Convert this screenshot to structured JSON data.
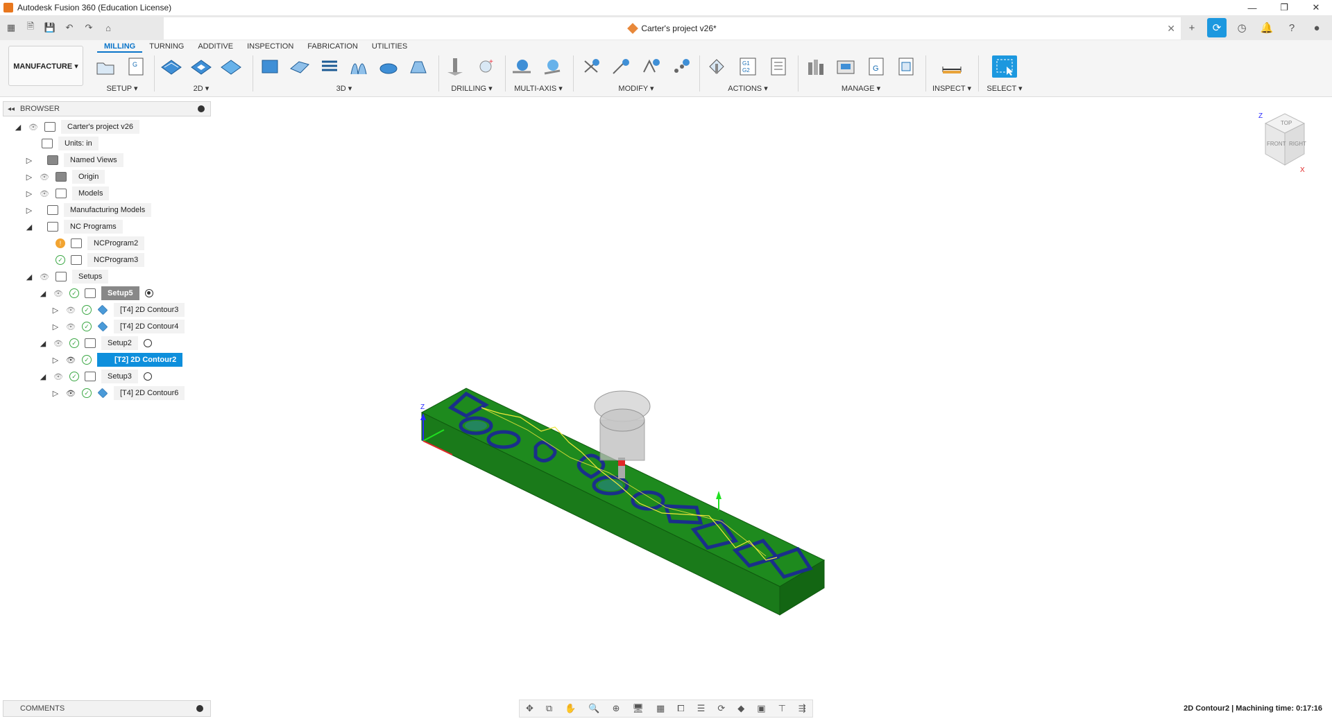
{
  "window": {
    "title": "Autodesk Fusion 360 (Education License)",
    "controls": [
      "—",
      "❐",
      "✕"
    ]
  },
  "document": {
    "tab_title": "Carter's project v26*"
  },
  "workspace": {
    "label": "MANUFACTURE ▾"
  },
  "ribbon": {
    "tabs": [
      "MILLING",
      "TURNING",
      "ADDITIVE",
      "INSPECTION",
      "FABRICATION",
      "UTILITIES"
    ],
    "groups": {
      "setup": "SETUP ▾",
      "two_d": "2D ▾",
      "three_d": "3D ▾",
      "drilling": "DRILLING ▾",
      "multi_axis": "MULTI-AXIS ▾",
      "modify": "MODIFY ▾",
      "actions": "ACTIONS ▾",
      "manage": "MANAGE ▾",
      "inspect": "INSPECT ▾",
      "select": "SELECT ▾"
    }
  },
  "browser": {
    "title": "BROWSER",
    "tree": {
      "root": "Carter's project v26",
      "units": "Units: in",
      "named_views": "Named Views",
      "origin": "Origin",
      "models": "Models",
      "manufacturing_models": "Manufacturing Models",
      "nc_programs": "NC Programs",
      "ncprogram2": "NCProgram2",
      "ncprogram3": "NCProgram3",
      "setups": "Setups",
      "setup5": "Setup5",
      "contour3": "[T4] 2D Contour3",
      "contour4": "[T4] 2D Contour4",
      "setup2": "Setup2",
      "contour2": "[T2] 2D Contour2",
      "setup3": "Setup3",
      "contour6": "[T4] 2D Contour6"
    }
  },
  "viewcube": {
    "top": "TOP",
    "front": "FRONT",
    "right": "RIGHT",
    "z": "Z",
    "x": "X"
  },
  "axes": {
    "z": "Z"
  },
  "comments": {
    "title": "COMMENTS"
  },
  "status": {
    "text": "2D Contour2 | Machining time: 0:17:16"
  },
  "colors": {
    "accent": "#0e8fdc",
    "stock": "#1f8a1f",
    "toolpath": "#f1e83a"
  }
}
